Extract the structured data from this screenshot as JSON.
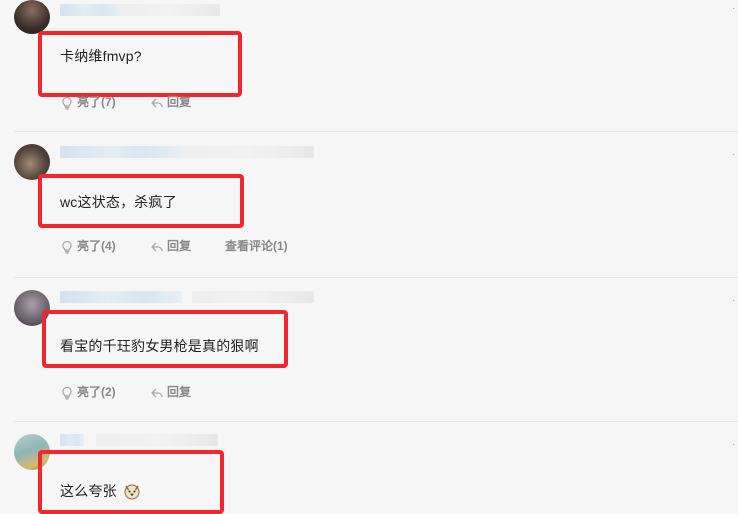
{
  "comments": [
    {
      "text": "卡纳维fmvp?",
      "likes_label": "亮了(7)",
      "reply_label": "回复",
      "view_replies_label": ""
    },
    {
      "text": "wc这状态，杀疯了",
      "likes_label": "亮了(4)",
      "reply_label": "回复",
      "view_replies_label": "查看评论(1)"
    },
    {
      "text": "看宝的千玨豹女男枪是真的狠啊",
      "likes_label": "亮了(2)",
      "reply_label": "回复",
      "view_replies_label": ""
    },
    {
      "text": "这么夸张",
      "likes_label": "",
      "reply_label": "",
      "view_replies_label": ""
    }
  ],
  "colors": {
    "highlight_border": "#f2262e",
    "background": "#f6f6f6",
    "action_text": "#888888"
  },
  "icons": {
    "like": "lightbulb-icon",
    "reply": "reply-arrow-icon",
    "emoji": "dog-face-emoji-icon"
  }
}
